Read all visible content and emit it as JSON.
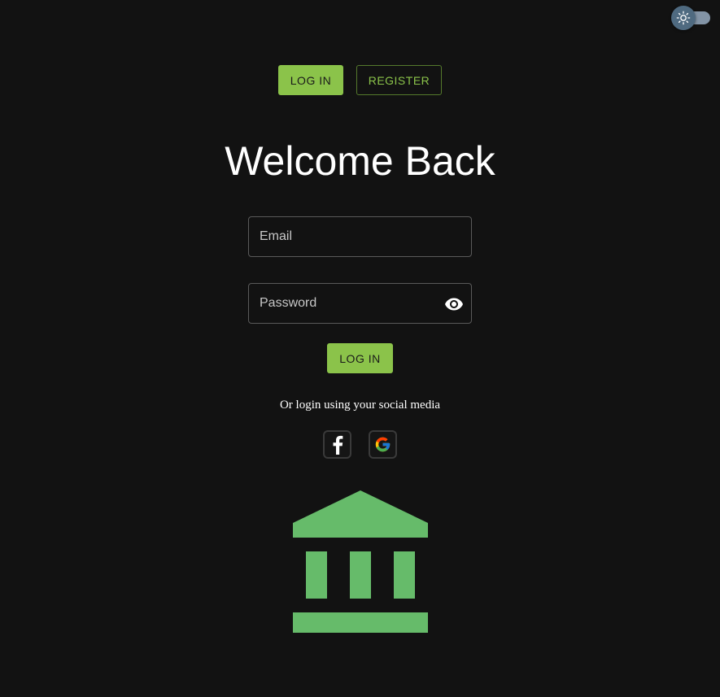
{
  "theme_toggle": {
    "icon": "sun-icon",
    "state": "light"
  },
  "tabs": [
    {
      "label": "LOG IN",
      "active": true
    },
    {
      "label": "REGISTER",
      "active": false
    }
  ],
  "title": "Welcome Back",
  "form": {
    "email": {
      "placeholder": "Email",
      "value": ""
    },
    "password": {
      "placeholder": "Password",
      "value": ""
    },
    "submit_label": "LOG IN"
  },
  "social": {
    "prompt": "Or login using your social media",
    "providers": [
      {
        "name": "facebook",
        "icon": "facebook-icon"
      },
      {
        "name": "google",
        "icon": "google-icon"
      }
    ]
  },
  "logo": {
    "icon": "bank-icon"
  },
  "colors": {
    "accent": "#8bc34a",
    "background": "#121212",
    "logo": "#66bb6a"
  }
}
